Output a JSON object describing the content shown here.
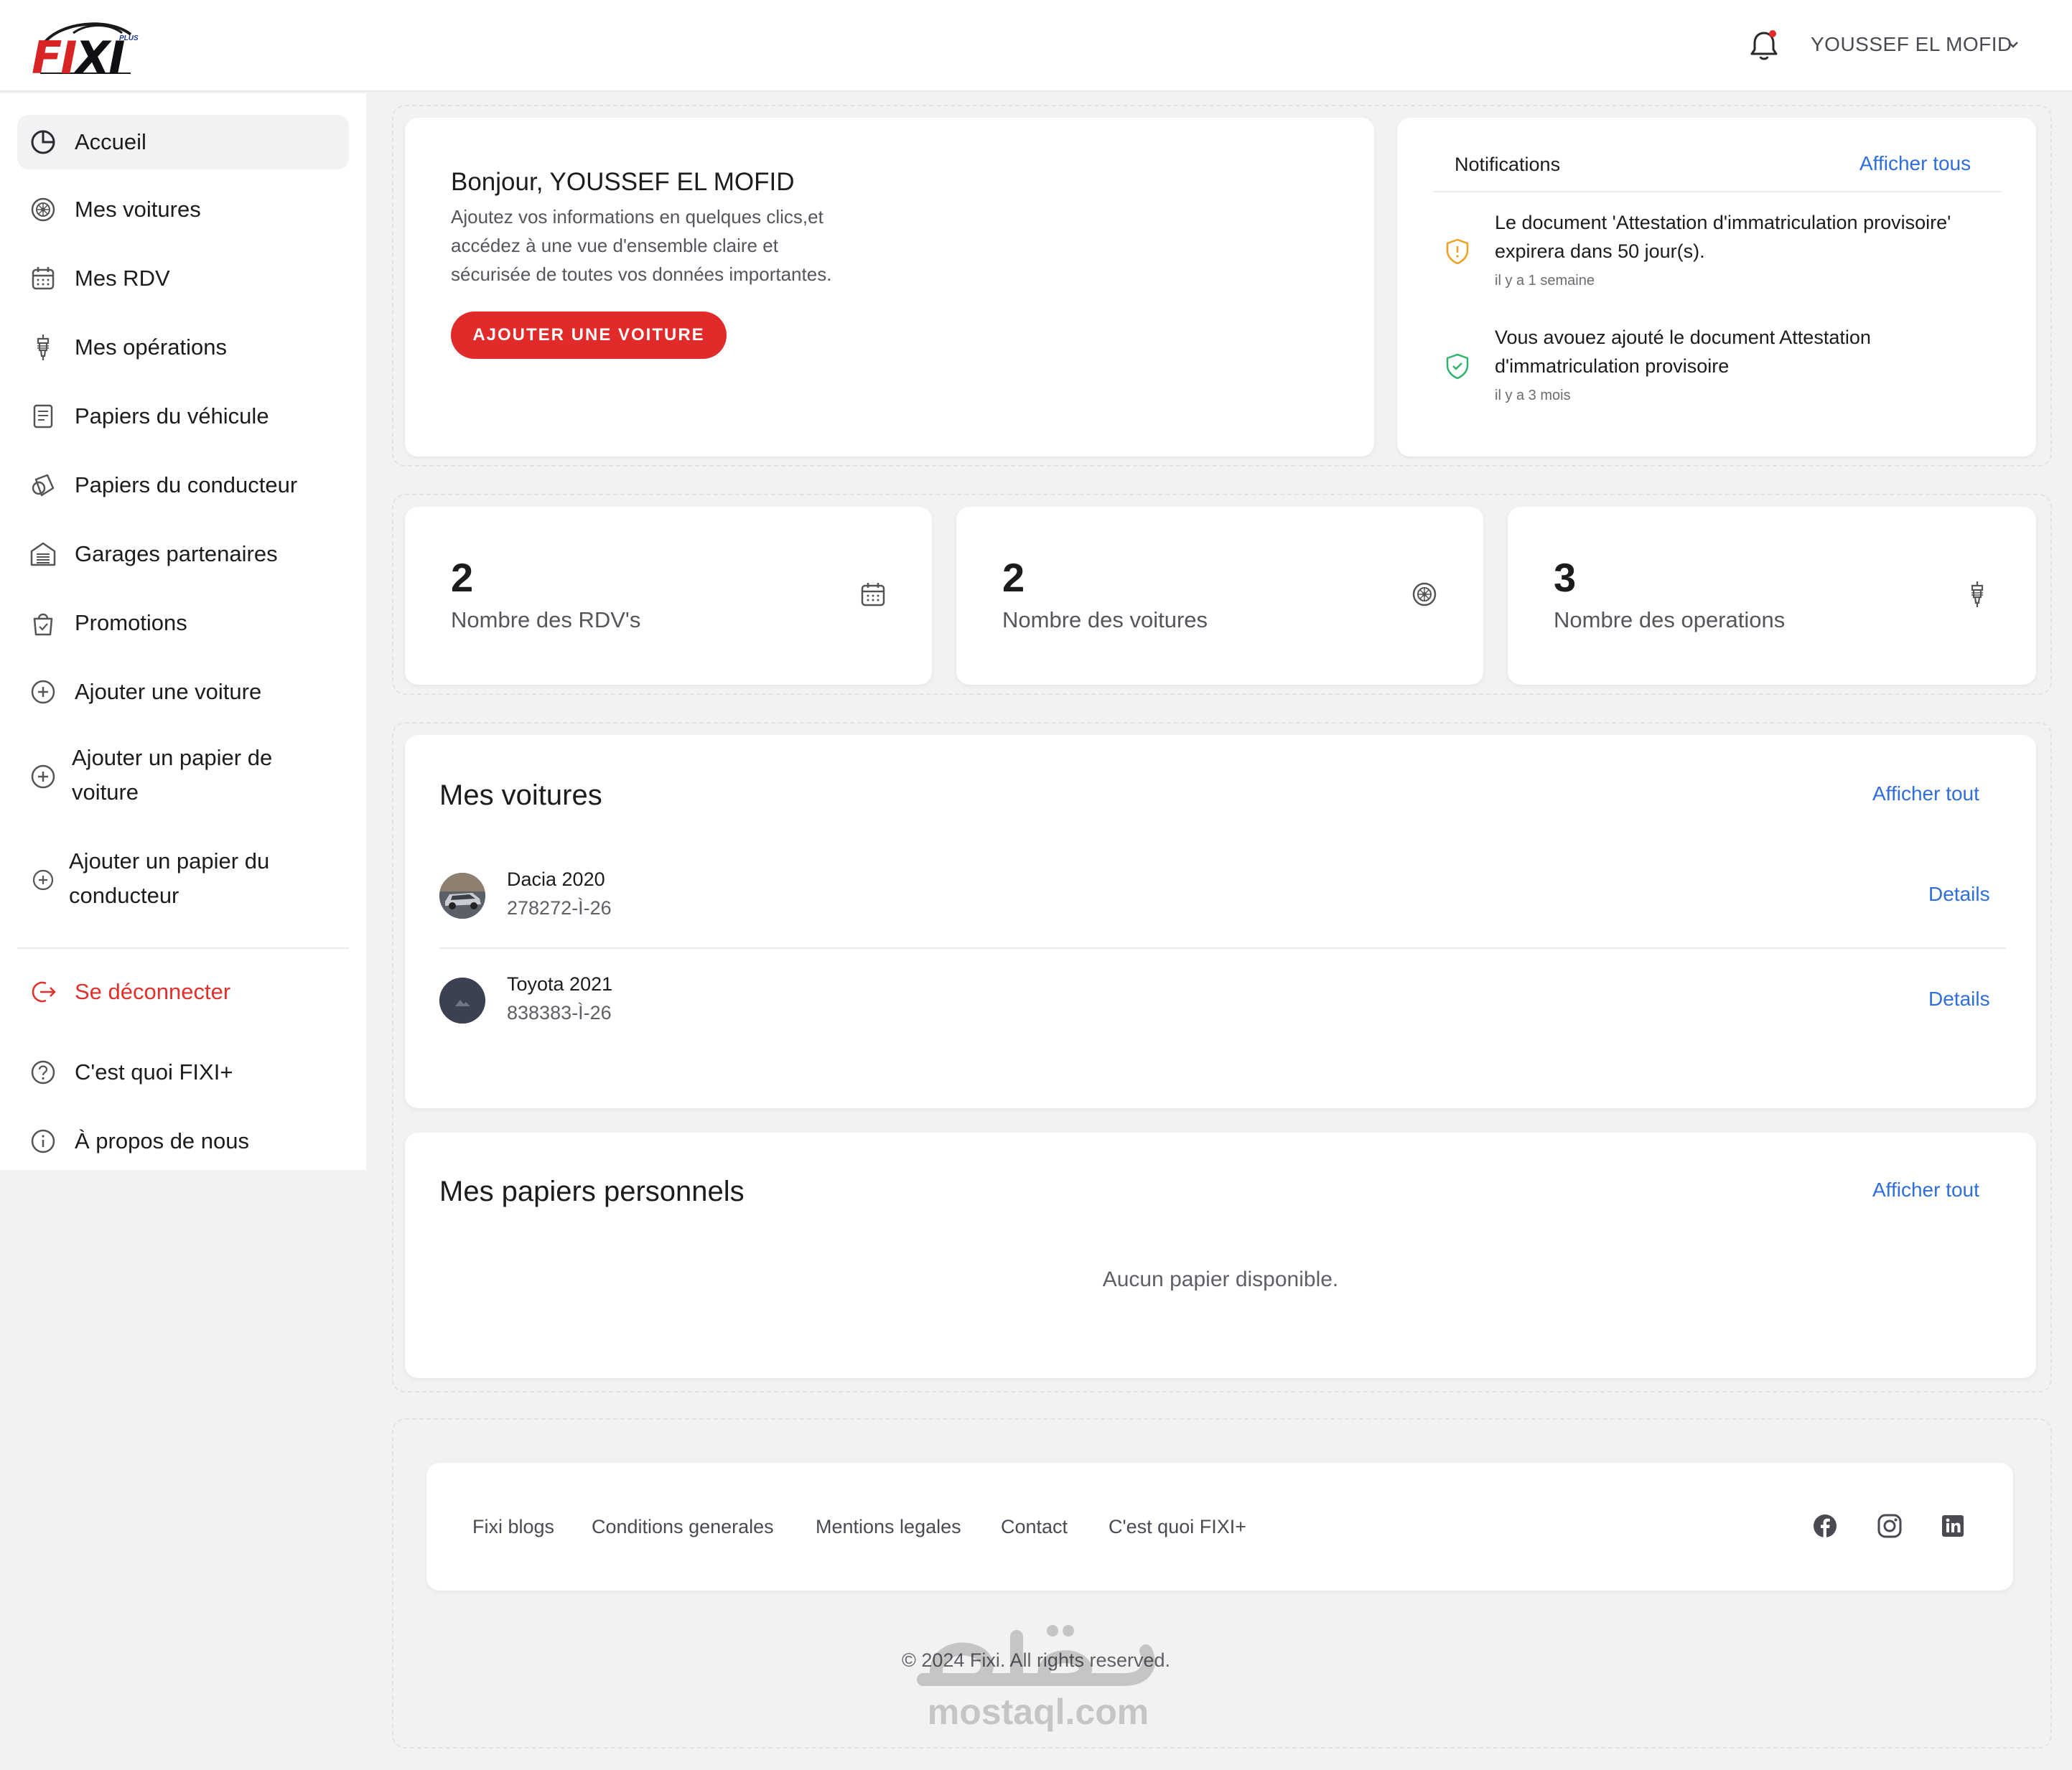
{
  "brand": {
    "logo_fi": "FI",
    "logo_xi": "XI",
    "logo_plus": "PLUS"
  },
  "header": {
    "user_name": "YOUSSEF EL MOFID"
  },
  "sidebar": {
    "items": [
      {
        "label": "Accueil",
        "icon": "pie-chart-icon"
      },
      {
        "label": "Mes voitures",
        "icon": "wheel-icon"
      },
      {
        "label": "Mes RDV",
        "icon": "calendar-icon"
      },
      {
        "label": "Mes opérations",
        "icon": "spark-plug-icon"
      },
      {
        "label": "Papiers du véhicule",
        "icon": "document-icon"
      },
      {
        "label": "Papiers du conducteur",
        "icon": "license-icon"
      },
      {
        "label": "Garages partenaires",
        "icon": "garage-icon"
      },
      {
        "label": "Promotions",
        "icon": "promo-bag-icon"
      },
      {
        "label": "Ajouter une voiture",
        "icon": "plus-circle-icon"
      },
      {
        "label_line1": "Ajouter un papier de",
        "label_line2": "voiture",
        "icon": "plus-circle-icon"
      },
      {
        "label_line1": "Ajouter un papier du",
        "label_line2": "conducteur",
        "icon": "plus-circle-icon"
      }
    ],
    "logout": "Se déconnecter",
    "about_fixi": "C'est quoi FIXI+",
    "about_us": "À propos de nous"
  },
  "welcome": {
    "title": "Bonjour, YOUSSEF EL MOFID",
    "line1": "Ajoutez vos informations en quelques clics,et",
    "line2": "accédez à une vue d'ensemble claire et",
    "line3": "sécurisée de toutes vos données importantes.",
    "button": "AJOUTER UNE VOITURE"
  },
  "notifications": {
    "title": "Notifications",
    "show_all": "Afficher tous",
    "items": [
      {
        "line1": "Le document 'Attestation d'immatriculation provisoire'",
        "line2": "expirera dans 50 jour(s).",
        "time": "il y a 1 semaine",
        "status": "warning",
        "color": "#f0a020"
      },
      {
        "line1": "Vous avouez ajouté le document Attestation",
        "line2": "d'immatriculation provisoire",
        "time": "il y a 3 mois",
        "status": "success",
        "color": "#2fb36a"
      }
    ]
  },
  "stats": [
    {
      "value": "2",
      "label": "Nombre des RDV's",
      "icon": "calendar-icon"
    },
    {
      "value": "2",
      "label": "Nombre des voitures",
      "icon": "wheel-icon"
    },
    {
      "value": "3",
      "label": "Nombre des operations",
      "icon": "spark-plug-icon"
    }
  ],
  "cars": {
    "title": "Mes voitures",
    "show_all": "Afficher tout",
    "items": [
      {
        "name": "Dacia 2020",
        "plate": "278272-Ì-26",
        "action": "Details"
      },
      {
        "name": "Toyota 2021",
        "plate": "838383-Ì-26",
        "action": "Details"
      }
    ]
  },
  "papers": {
    "title": "Mes papiers personnels",
    "show_all": "Afficher tout",
    "empty": "Aucun papier disponible."
  },
  "footer": {
    "links": [
      "Fixi blogs",
      "Conditions generales",
      "Mentions legales",
      "Contact",
      "C'est quoi FIXI+"
    ],
    "social": [
      "facebook-icon",
      "instagram-icon",
      "linkedin-icon"
    ],
    "copyright": "© 2024 Fixi. All rights reserved."
  },
  "watermark": {
    "text": "mostaql.com"
  },
  "colors": {
    "accent_red": "#e12a2a",
    "link_blue": "#2f6edb",
    "background": "#f2f2f3"
  }
}
